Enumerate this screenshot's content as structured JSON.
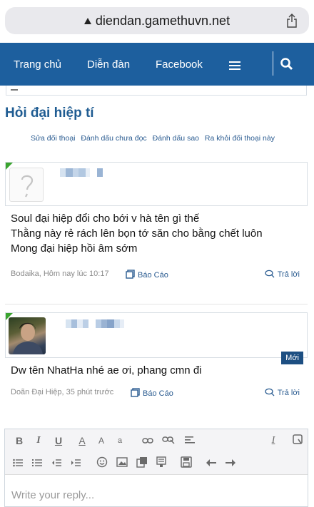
{
  "browser": {
    "url": "diendan.gamethuvn.net"
  },
  "nav": {
    "items": [
      "Trang chủ",
      "Diễn đàn",
      "Facebook"
    ]
  },
  "thread": {
    "title": "Hỏi đại hiệp tí",
    "actions": [
      "Sửa đối thoại",
      "Đánh dấu chưa đọc",
      "Đánh dấu sao",
      "Ra khỏi đối thoại này"
    ]
  },
  "posts": [
    {
      "lines": [
        "Soul đại hiệp đổi cho bới v hà tên gì thế",
        "Thằng này rẻ rách lên bọn tớ săn cho bằng chết luôn",
        "Mong đại hiệp hồi âm sớm"
      ],
      "meta": "Bodaika, Hôm nay lúc 10:17",
      "report": "Báo Cáo",
      "reply": "Trả lời"
    },
    {
      "lines": [
        "Dw tên NhatHa nhé ae ơi, phang cmn đi"
      ],
      "meta": "Doãn Đại Hiệp, 35 phút trước",
      "report": "Báo Cáo",
      "reply": "Trả lời",
      "badge": "Mới"
    }
  ],
  "editor": {
    "toolbar1": [
      "B",
      "I",
      "U",
      "A",
      "A",
      "a",
      "link",
      "unlink",
      "align",
      "clear-format",
      "toggle"
    ],
    "placeholder": "Write your reply..."
  },
  "colors": {
    "nav": "#1d5f9e",
    "link": "#2b5c91",
    "title": "#1f5c92",
    "badge": "#1d4f82"
  }
}
